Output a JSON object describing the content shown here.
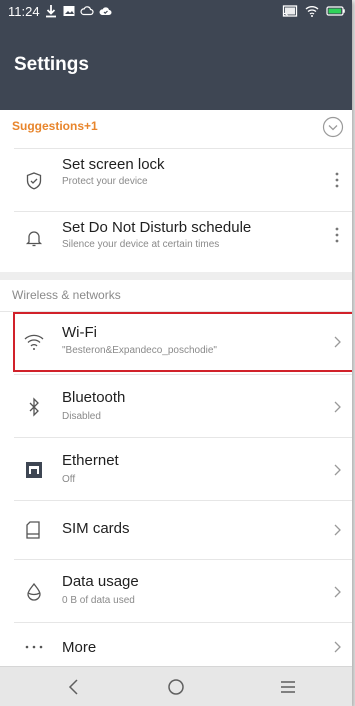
{
  "status_bar": {
    "time": "11:24",
    "left_icons": [
      "download-icon",
      "image-icon",
      "cloud-icon",
      "drive-icon"
    ],
    "right_icons": [
      "cast-icon",
      "wifi-signal-icon",
      "battery-icon"
    ]
  },
  "app_bar": {
    "title": "Settings"
  },
  "suggestions": {
    "title": "Suggestions+1",
    "items": [
      {
        "title": "Set screen lock",
        "subtitle": "Protect your device",
        "icon": "shield-icon"
      },
      {
        "title": "Set Do Not Disturb schedule",
        "subtitle": "Silence your device at certain times",
        "icon": "bell-icon"
      }
    ]
  },
  "wireless": {
    "header": "Wireless & networks",
    "items": [
      {
        "title": "Wi-Fi",
        "subtitle": "\"Besteron&Expandeco_poschodie\"",
        "icon": "wifi-icon"
      },
      {
        "title": "Bluetooth",
        "subtitle": "Disabled",
        "icon": "bluetooth-icon"
      },
      {
        "title": "Ethernet",
        "subtitle": "Off",
        "icon": "ethernet-icon"
      },
      {
        "title": "SIM cards",
        "subtitle": "",
        "icon": "sim-card-icon"
      },
      {
        "title": "Data usage",
        "subtitle": "0 B of data used",
        "icon": "data-drop-icon"
      },
      {
        "title": "More",
        "subtitle": "",
        "icon": "more-dots-icon"
      }
    ]
  },
  "nav_bar": {
    "buttons": [
      "back-icon",
      "home-icon",
      "menu-icon"
    ]
  },
  "colors": {
    "app_bar": "#3e4653",
    "accent": "#e8852c",
    "highlight": "#d1212a"
  }
}
